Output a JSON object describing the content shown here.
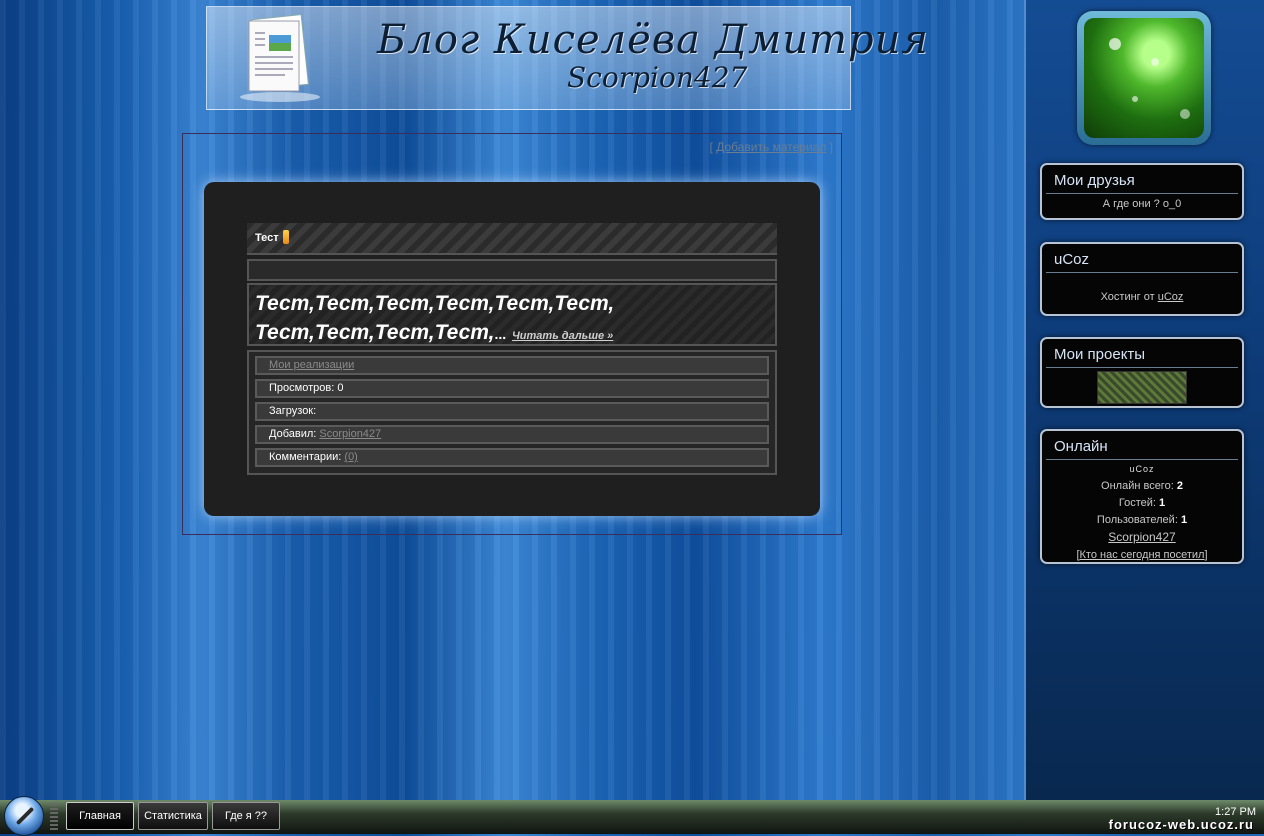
{
  "header": {
    "title": "Блог Киселёва Дмитрия",
    "subtitle": "Scorpion427"
  },
  "content": {
    "add_material": "Добавить материал",
    "entry": {
      "title": "Тест",
      "text_line1": "Тест,Тест,Тест,Тест,Тест,Тест,",
      "text_line2": "Тест,Тест,Тест,Тест,",
      "ellipsis": "...",
      "read_more": "Читать дальше »"
    },
    "details": {
      "category": "Мои реализации",
      "views_label": "Просмотров:",
      "views_value": "0",
      "downloads_label": "Загрузок:",
      "added_by_label": "Добавил:",
      "added_by_value": "Scorpion427",
      "comments_label": "Комментарии:",
      "comments_value": "(0)"
    }
  },
  "sidebar": {
    "friends": {
      "title": "Мои друзья",
      "text": "А где они ? о_0"
    },
    "ucoz": {
      "title": "uCoz",
      "text": "Хостинг от",
      "link": "uCoz"
    },
    "projects": {
      "title": "Мои проекты"
    },
    "online": {
      "title": "Онлайн",
      "ucoz_mini": "uCoz",
      "total_label": "Онлайн всего:",
      "total_value": "2",
      "guests_label": "Гостей:",
      "guests_value": "1",
      "users_label": "Пользователей:",
      "users_value": "1",
      "user_link": "Scorpion427",
      "visitors_link": "Кто нас сегодня посетил"
    }
  },
  "taskbar": {
    "buttons": [
      "Главная",
      "Статистика",
      "Где я ??"
    ],
    "clock": "1:27 PM"
  },
  "watermark": "forucoz-web.ucoz.ru",
  "colors": {
    "accent": "#1a63b5",
    "link_red": "#d41e1e"
  }
}
